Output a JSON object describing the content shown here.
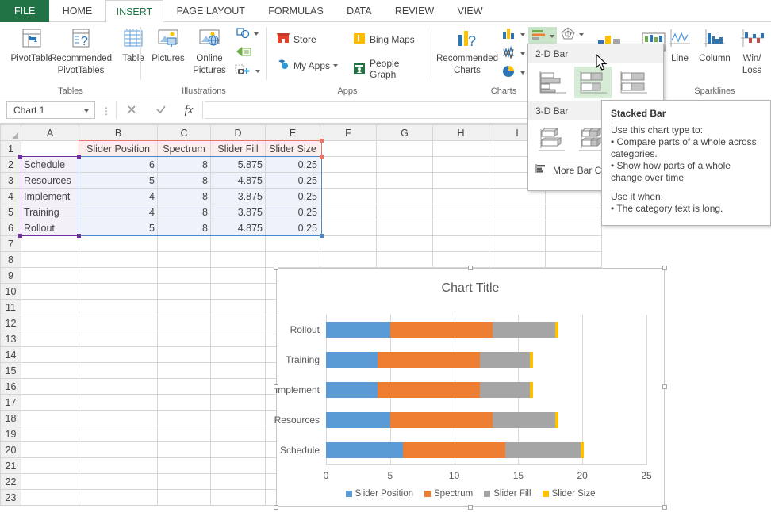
{
  "app": {
    "title": "Excel"
  },
  "ribbon": {
    "tabs": [
      {
        "label": "FILE",
        "state": "file"
      },
      {
        "label": "HOME",
        "state": "normal"
      },
      {
        "label": "INSERT",
        "state": "active"
      },
      {
        "label": "PAGE LAYOUT",
        "state": "normal"
      },
      {
        "label": "FORMULAS",
        "state": "normal"
      },
      {
        "label": "DATA",
        "state": "normal"
      },
      {
        "label": "REVIEW",
        "state": "normal"
      },
      {
        "label": "VIEW",
        "state": "normal"
      }
    ],
    "groups": [
      {
        "name": "Tables"
      },
      {
        "name": "Illustrations"
      },
      {
        "name": "Apps"
      },
      {
        "name": "Charts"
      },
      {
        "name": "Sparklines"
      }
    ],
    "tables": {
      "pivottable": "PivotTable",
      "recommended_pivottables": "Recommended\nPivotTables",
      "recommended_pivottables_l1": "Recommended",
      "recommended_pivottables_l2": "PivotTables",
      "table": "Table"
    },
    "illustrations": {
      "pictures": "Pictures",
      "online_pictures_l1": "Online",
      "online_pictures_l2": "Pictures",
      "shapes_icon": "shapes-icon",
      "smartart_icon": "smartart-icon",
      "screenshot_icon": "screenshot-icon"
    },
    "apps": {
      "store": "Store",
      "my_apps": "My Apps",
      "bing_maps": "Bing Maps",
      "people_graph": "People Graph"
    },
    "charts": {
      "recommended_charts_l1": "Recommended",
      "recommended_charts_l2": "Charts",
      "column_icon": "column-chart-icon",
      "bar_icon": "bar-chart-icon",
      "stock_icon": "stock-chart-icon",
      "line_icon": "line-chart-icon",
      "pie_icon": "pie-chart-icon",
      "scatter_icon": "scatter-chart-icon",
      "combo_icon": "combo-chart-icon",
      "pivotchart_icon": "pivotchart-icon"
    },
    "sparklines": {
      "line": "Line",
      "column": "Column",
      "winloss_l1": "Win/",
      "winloss_l2": "Loss"
    }
  },
  "formula_bar": {
    "name_box_value": "Chart 1",
    "cancel_icon": "cancel-icon",
    "enter_icon": "confirm-icon",
    "function_icon": "fx-icon",
    "formula_value": ""
  },
  "grid": {
    "columns": [
      "A",
      "B",
      "C",
      "D",
      "E",
      "F",
      "G",
      "H",
      "I"
    ],
    "rows": [
      "1",
      "2",
      "3",
      "4",
      "5",
      "6",
      "7",
      "8",
      "9",
      "10",
      "11",
      "12",
      "13",
      "14",
      "15",
      "16",
      "17",
      "18",
      "19",
      "20",
      "21",
      "22",
      "23"
    ],
    "header_row": [
      "",
      "Slider Position",
      "Spectrum",
      "Slider Fill",
      "Slider Size"
    ],
    "data_rows": [
      {
        "label": "Schedule",
        "values": [
          "6",
          "8",
          "5.875",
          "0.25"
        ]
      },
      {
        "label": "Resources",
        "values": [
          "5",
          "8",
          "4.875",
          "0.25"
        ]
      },
      {
        "label": "Implement",
        "values": [
          "4",
          "8",
          "3.875",
          "0.25"
        ]
      },
      {
        "label": "Training",
        "values": [
          "4",
          "8",
          "3.875",
          "0.25"
        ]
      },
      {
        "label": "Rollout",
        "values": [
          "5",
          "8",
          "4.875",
          "0.25"
        ]
      }
    ]
  },
  "gallery": {
    "section_2d": "2-D Bar",
    "section_3d": "3-D Bar",
    "more_label": "More Bar Charts...",
    "more_label_visible": "More Bar Ch",
    "items_2d": [
      "clustered-bar",
      "stacked-bar",
      "100-percent-stacked-bar"
    ],
    "items_3d": [
      "3d-clustered-bar",
      "3d-stacked-bar",
      "3d-100-percent-stacked-bar"
    ],
    "selected": "stacked-bar"
  },
  "tooltip": {
    "title": "Stacked Bar",
    "lines": [
      "Use this chart type to:",
      "• Compare parts of a whole across",
      "categories.",
      "• Show how parts of a whole",
      "change over time"
    ],
    "lines2": [
      "Use it when:",
      "• The category text is long."
    ]
  },
  "chart_data": {
    "type": "bar",
    "orientation": "horizontal",
    "stacked": true,
    "title": "Chart Title",
    "categories": [
      "Schedule",
      "Resources",
      "Implement",
      "Training",
      "Rollout"
    ],
    "series": [
      {
        "name": "Slider Position",
        "color": "#5B9BD5",
        "values": [
          6,
          5,
          4,
          4,
          5
        ]
      },
      {
        "name": "Spectrum",
        "color": "#ED7D31",
        "values": [
          8,
          8,
          8,
          8,
          8
        ]
      },
      {
        "name": "Slider Fill",
        "color": "#A5A5A5",
        "values": [
          5.875,
          4.875,
          3.875,
          3.875,
          4.875
        ]
      },
      {
        "name": "Slider Size",
        "color": "#FFC000",
        "values": [
          0.25,
          0.25,
          0.25,
          0.25,
          0.25
        ]
      }
    ],
    "xlabel": "",
    "ylabel": "",
    "xlim": [
      0,
      25
    ],
    "xticks": [
      0,
      5,
      10,
      15,
      20,
      25
    ],
    "grid": true,
    "legend_position": "bottom"
  },
  "colors": {
    "excel_green": "#217346",
    "series_blue": "#5B9BD5",
    "series_orange": "#ED7D31",
    "series_gray": "#A5A5A5",
    "series_yellow": "#FFC000"
  }
}
